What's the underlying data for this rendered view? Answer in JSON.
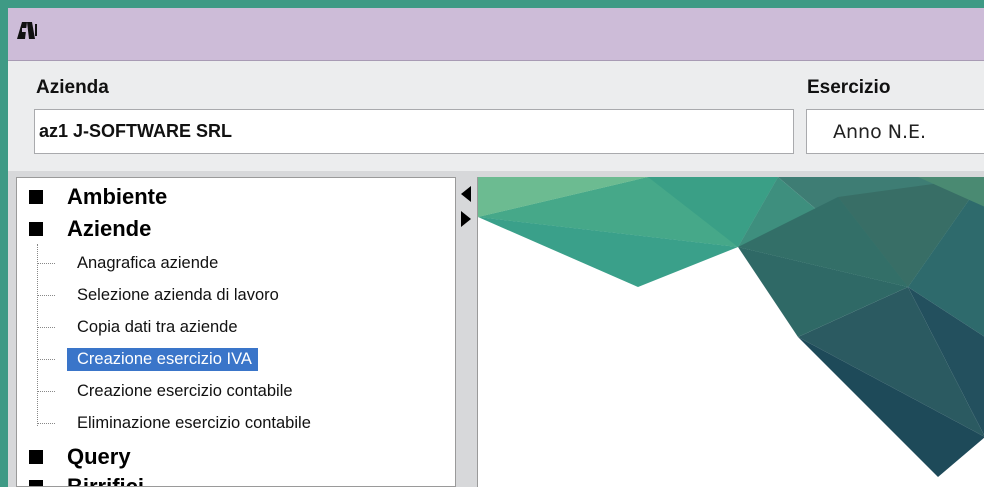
{
  "titlebar": {
    "icon": "app-logo-icon"
  },
  "azienda": {
    "label": "Azienda",
    "value": "az1 J-SOFTWARE SRL"
  },
  "esercizio": {
    "label": "Esercizio",
    "value": "Anno N.E."
  },
  "tree": {
    "groups": [
      {
        "label": "Ambiente"
      },
      {
        "label": "Aziende"
      },
      {
        "label": "Query"
      },
      {
        "label": "Birrifici"
      }
    ],
    "aziende_items": [
      {
        "label": "Anagrafica aziende"
      },
      {
        "label": "Selezione azienda di lavoro"
      },
      {
        "label": "Copia dati tra aziende"
      },
      {
        "label": "Creazione esercizio IVA",
        "selected": true
      },
      {
        "label": "Creazione esercizio contabile"
      },
      {
        "label": "Eliminazione esercizio contabile"
      }
    ]
  },
  "splitter": {
    "collapse_icon": "arrow-left-icon",
    "expand_icon": "arrow-right-icon"
  },
  "colors": {
    "border_accent": "#3e9a85",
    "titlebar": "#cdbcd8",
    "selection": "#3a75c9",
    "polygon_teal": "#3a9f86",
    "polygon_dark": "#1f4d5e"
  }
}
